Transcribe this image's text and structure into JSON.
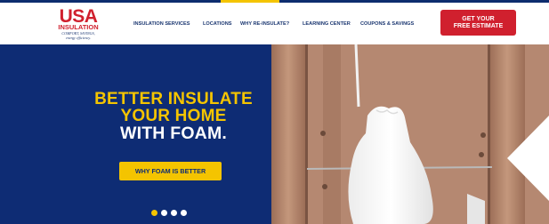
{
  "brand": {
    "name": "USA",
    "sub": "INSULATION",
    "tagline_1": "COMFORT, SAVINGS,",
    "tagline_2": "energy efficiency."
  },
  "nav": {
    "items": [
      {
        "label": "INSULATION SERVICES"
      },
      {
        "label": "LOCATIONS"
      },
      {
        "label": "WHY RE-INSULATE?"
      },
      {
        "label": "LEARNING CENTER"
      },
      {
        "label": "COUPONS & SAVINGS"
      }
    ],
    "cta_line1": "GET YOUR",
    "cta_line2": "FREE ESTIMATE"
  },
  "hero": {
    "line1": "BETTER INSULATE",
    "line2": "YOUR HOME",
    "line3": "WITH FOAM.",
    "button": "WHY FOAM IS BETTER",
    "slide_count": 4,
    "active_slide": 1
  },
  "colors": {
    "navy": "#0e2c74",
    "gold": "#f4c400",
    "red": "#d0202e",
    "white": "#ffffff"
  }
}
